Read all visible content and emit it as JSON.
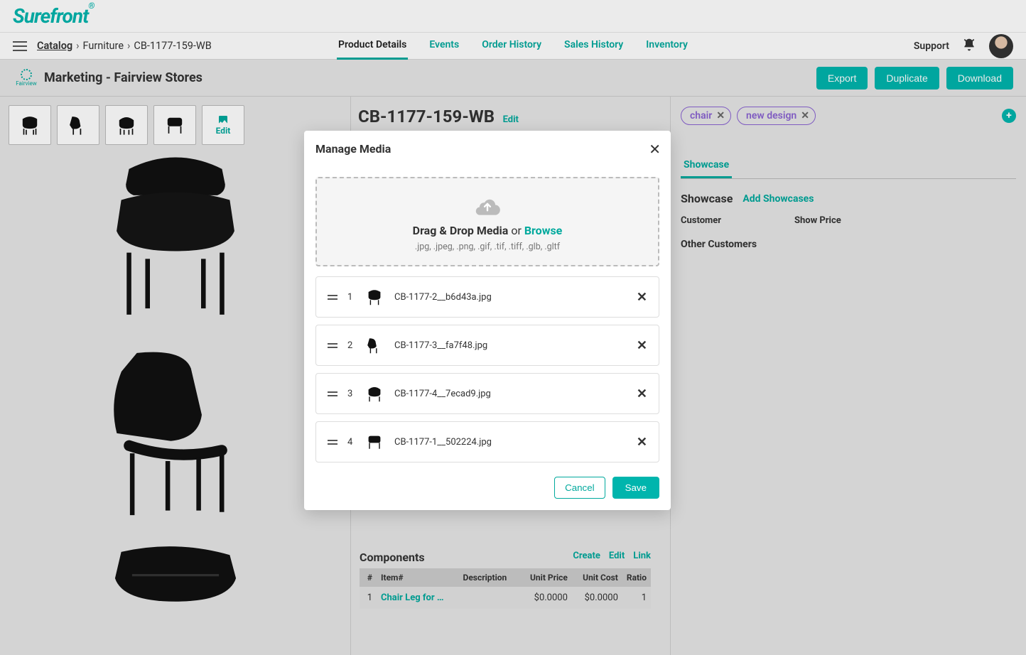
{
  "brand": "Surefront",
  "topnav": {
    "support": "Support",
    "tabs": [
      "Product Details",
      "Events",
      "Order History",
      "Sales History",
      "Inventory"
    ],
    "activeTab": 0
  },
  "breadcrumb": {
    "root": "Catalog",
    "a": "Furniture",
    "b": "CB-1177-159-WB"
  },
  "subhead": {
    "orgLabel": "Fairview",
    "title": "Marketing - Fairview Stores",
    "buttons": {
      "export": "Export",
      "duplicate": "Duplicate",
      "download": "Download"
    }
  },
  "thumbs": {
    "editLabel": "Edit"
  },
  "mid": {
    "sku": "CB-1177-159-WB",
    "edit": "Edit"
  },
  "right": {
    "tags": [
      {
        "label": "chair"
      },
      {
        "label": "new design"
      }
    ],
    "tab": "Showcase",
    "showcaseTitle": "Showcase",
    "addShowcases": "Add Showcases",
    "colCustomer": "Customer",
    "colShowPrice": "Show Price",
    "otherCustomers": "Other Customers"
  },
  "components": {
    "title": "Components",
    "create": "Create",
    "edit": "Edit",
    "link": "Link",
    "head": {
      "n": "#",
      "item": "Item#",
      "desc": "Description",
      "unitPrice": "Unit Price",
      "unitCost": "Unit Cost",
      "ratio": "Ratio"
    },
    "row": {
      "n": "1",
      "item": "Chair Leg for …",
      "unitPrice": "$0.0000",
      "unitCost": "$0.0000",
      "ratio": "1"
    }
  },
  "modal": {
    "title": "Manage Media",
    "drop": {
      "main": "Drag & Drop Media",
      "or": "or",
      "browse": "Browse",
      "sub": ".jpg, .jpeg, .png, .gif, .tif, .tiff, .glb, .gltf"
    },
    "items": [
      {
        "n": "1",
        "file": "CB-1177-2__b6d43a.jpg"
      },
      {
        "n": "2",
        "file": "CB-1177-3__fa7f48.jpg"
      },
      {
        "n": "3",
        "file": "CB-1177-4__7ecad9.jpg"
      },
      {
        "n": "4",
        "file": "CB-1177-1__502224.jpg"
      }
    ],
    "cancel": "Cancel",
    "save": "Save"
  }
}
